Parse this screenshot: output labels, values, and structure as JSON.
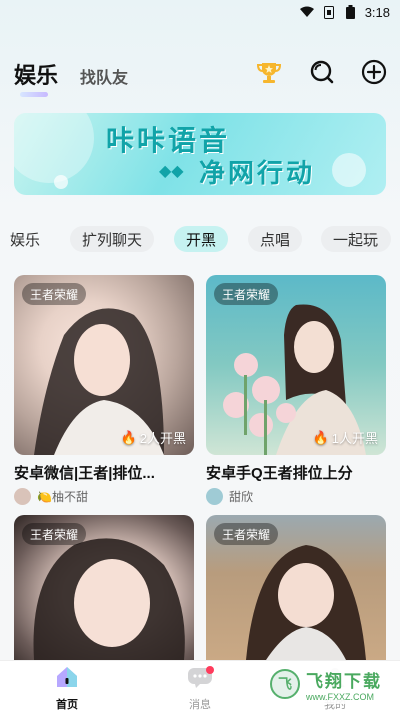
{
  "status_bar": {
    "time": "3:18"
  },
  "header": {
    "tab_active": "娱乐",
    "tab_other": "找队友",
    "icons": [
      "trophy-icon",
      "search-icon",
      "add-icon"
    ]
  },
  "banner": {
    "line1": "咔咔语音",
    "line2": "净网行动",
    "diamonds": "◆◆"
  },
  "chips": [
    "娱乐",
    "扩列聊天",
    "开黑",
    "点唱",
    "一起玩"
  ],
  "active_chip": "开黑",
  "cards": [
    {
      "tag": "王者荣耀",
      "count": "2人开黑",
      "title": "安卓微信|王者|排位...",
      "user": "🍋柚不甜"
    },
    {
      "tag": "王者荣耀",
      "count": "1人开黑",
      "title": "安卓手Q王者排位上分",
      "user": "甜欣"
    },
    {
      "tag": "王者荣耀",
      "count": "",
      "title": "",
      "user": ""
    },
    {
      "tag": "王者荣耀",
      "count": "",
      "title": "",
      "user": ""
    }
  ],
  "bottom_nav": {
    "home": "首页",
    "messages": "消息",
    "mine": "我的"
  },
  "watermark": {
    "title": "飞翔下载",
    "url": "www.FXXZ.COM"
  },
  "colors": {
    "accent": "#11a3a8",
    "chip_active": "#c6f2f1",
    "badge": "#ff3b5c"
  }
}
